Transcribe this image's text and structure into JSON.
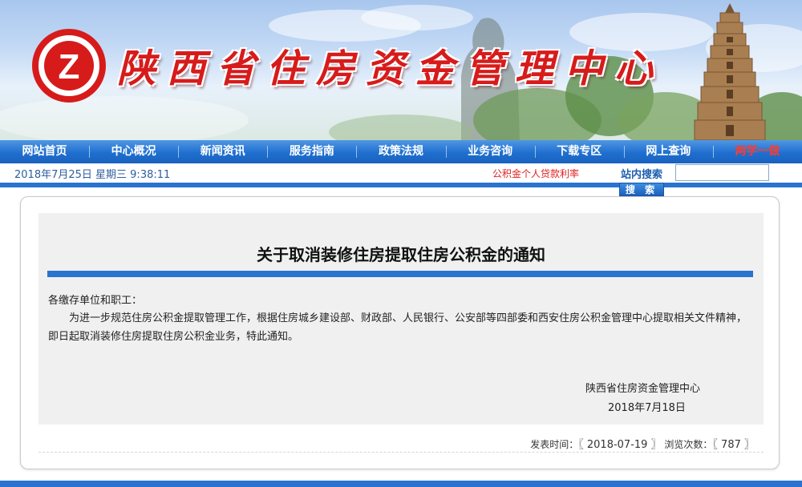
{
  "site": {
    "title": "陕西省住房资金管理中心",
    "logo_letter": "Z",
    "brand_color": "#d71b1b"
  },
  "nav": {
    "items": [
      {
        "label": "网站首页"
      },
      {
        "label": "中心概况"
      },
      {
        "label": "新闻资讯"
      },
      {
        "label": "服务指南"
      },
      {
        "label": "政策法规"
      },
      {
        "label": "业务咨询"
      },
      {
        "label": "下载专区"
      },
      {
        "label": "网上查询"
      },
      {
        "label": "两学一做"
      }
    ],
    "highlight_color": "#ff3b2f"
  },
  "infobar": {
    "datetime": "2018年7月25日 星期三 9:38:11",
    "ticker": "公积金个人贷款利率",
    "search_label": "站内搜索",
    "search_value": "",
    "search_button": "搜 索"
  },
  "article": {
    "title": "关于取消装修住房提取住房公积金的通知",
    "salutation": "各缴存单位和职工：",
    "body": "为进一步规范住房公积金提取管理工作，根据住房城乡建设部、财政部、人民银行、公安部等四部委和西安住房公积金管理中心提取相关文件精神，即日起取消装修住房提取住房公积金业务，特此通知。",
    "signature": "陕西省住房资金管理中心",
    "sign_date": "2018年7月18日"
  },
  "meta": {
    "publish_label": "发表时间：",
    "publish_date": "〖 2018-07-19 〗",
    "views_label": "浏览次数：",
    "views": "〖 787 〗"
  },
  "colors": {
    "nav_blue": "#1f6fd0",
    "rule_blue": "#2a73cf",
    "article_bg": "#f0f0f0"
  }
}
